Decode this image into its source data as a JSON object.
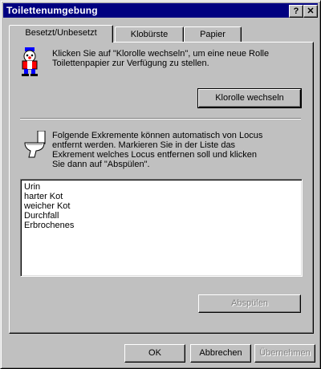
{
  "window": {
    "title": "Toilettenumgebung",
    "help_glyph": "?",
    "close_glyph": "✕"
  },
  "tabs": [
    {
      "label": "Besetzt/Unbesetzt"
    },
    {
      "label": "Klobürste"
    },
    {
      "label": "Papier"
    }
  ],
  "section1": {
    "line1": "Klicken Sie auf \"Klorolle wechseln\", um eine neue Rolle",
    "line2": "Toilettenpapier zur Verfügung zu stellen.",
    "button": "Klorolle wechseln",
    "icon": "toilet-paper-clown-icon"
  },
  "section2": {
    "line1": "Folgende Exkremente können automatisch von Locus",
    "line2": "entfernt werden. Markieren Sie in der Liste das",
    "line3": "Exkrement welches Locus entfernen soll und klicken",
    "line4": "Sie dann auf \"Abspülen\".",
    "icon": "toilet-icon",
    "list": [
      "Urin",
      "harter Kot",
      "weicher Kot",
      "Durchfall",
      "Erbrochenes"
    ],
    "flush_button": "Abspülen"
  },
  "footer": {
    "ok": "OK",
    "cancel": "Abbrechen",
    "apply": "Übernehmen"
  }
}
